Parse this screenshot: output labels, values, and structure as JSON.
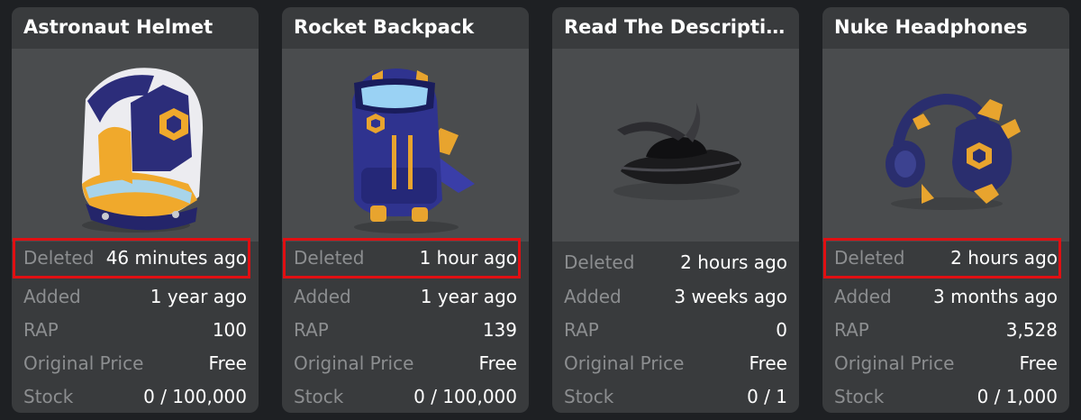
{
  "labels": {
    "deleted": "Deleted",
    "added": "Added",
    "rap": "RAP",
    "original_price": "Original Price",
    "stock": "Stock"
  },
  "colors": {
    "page_bg": "#1e2023",
    "card_bg": "#393b3d",
    "thumb_bg": "#4a4c4e",
    "label": "#8c8e90",
    "value": "#ffffff",
    "highlight": "#e10f12"
  },
  "items": [
    {
      "name": "Astronaut Helmet",
      "deleted": "46 minutes ago",
      "added": "1 year ago",
      "rap": "100",
      "original_price": "Free",
      "stock": "0 / 100,000",
      "highlighted": true,
      "image_icon": "astronaut-helmet-icon"
    },
    {
      "name": "Rocket Backpack",
      "deleted": "1 hour ago",
      "added": "1 year ago",
      "rap": "139",
      "original_price": "Free",
      "stock": "0 / 100,000",
      "highlighted": true,
      "image_icon": "rocket-backpack-icon"
    },
    {
      "name": "Read The Descriptio...",
      "deleted": "2 hours ago",
      "added": "3 weeks ago",
      "rap": "0",
      "original_price": "Free",
      "stock": "0 / 1",
      "highlighted": false,
      "image_icon": "fedora-hat-icon"
    },
    {
      "name": "Nuke Headphones",
      "deleted": "2 hours ago",
      "added": "3 months ago",
      "rap": "3,528",
      "original_price": "Free",
      "stock": "0 / 1,000",
      "highlighted": true,
      "image_icon": "headphones-icon"
    }
  ]
}
